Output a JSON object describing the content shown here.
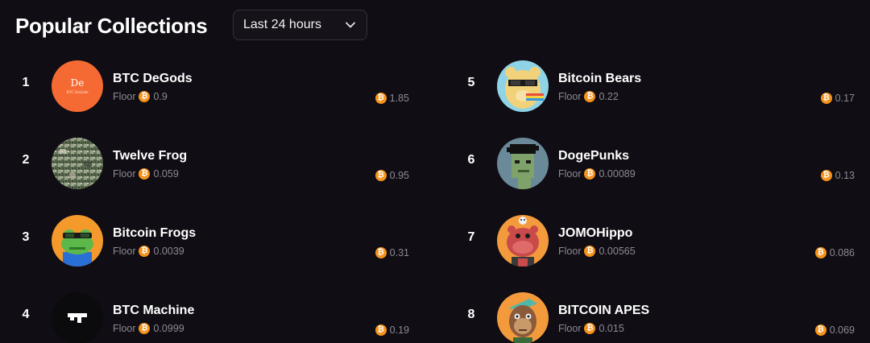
{
  "header": {
    "title": "Popular Collections",
    "range_select": {
      "value": "Last 24 hours"
    }
  },
  "floor_label": "Floor",
  "currency_icon": "bitcoin-icon",
  "accent_color": "#f7931a",
  "collections": [
    {
      "rank": "1",
      "name": "BTC DeGods",
      "floor": "0.9",
      "volume": "1.85",
      "avatar_text": "De",
      "avatar_subtext": "BTC DeGods"
    },
    {
      "rank": "2",
      "name": "Twelve Frog",
      "floor": "0.059",
      "volume": "0.95"
    },
    {
      "rank": "3",
      "name": "Bitcoin Frogs",
      "floor": "0.0039",
      "volume": "0.31"
    },
    {
      "rank": "4",
      "name": "BTC Machine",
      "floor": "0.0999",
      "volume": "0.19"
    },
    {
      "rank": "5",
      "name": "Bitcoin Bears",
      "floor": "0.22",
      "volume": "0.17"
    },
    {
      "rank": "6",
      "name": "DogePunks",
      "floor": "0.00089",
      "volume": "0.13"
    },
    {
      "rank": "7",
      "name": "JOMOHippo",
      "floor": "0.00565",
      "volume": "0.086"
    },
    {
      "rank": "8",
      "name": "BITCOIN APES",
      "floor": "0.015",
      "volume": "0.069"
    }
  ]
}
